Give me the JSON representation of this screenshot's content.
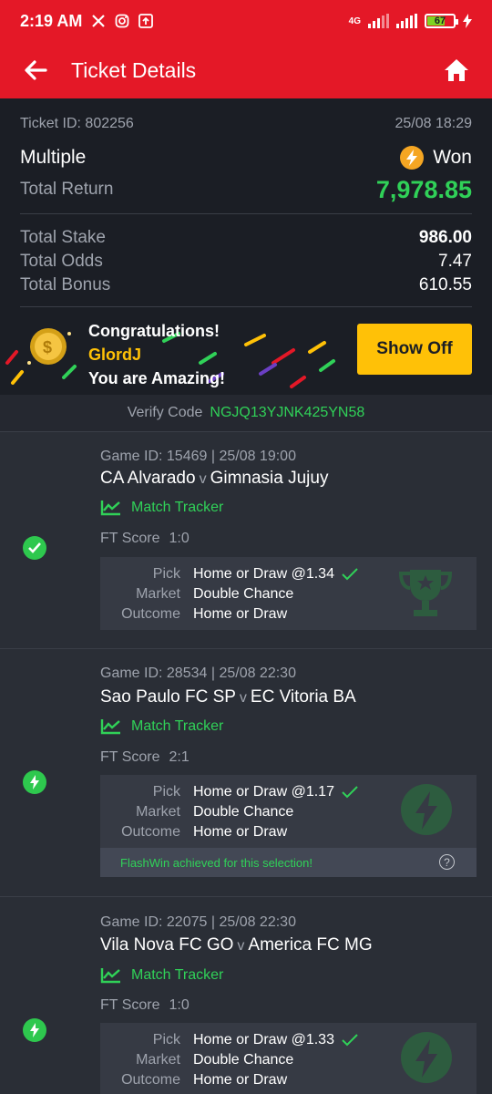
{
  "status_bar": {
    "time": "2:19 AM",
    "network": "4G",
    "battery": "67"
  },
  "header": {
    "title": "Ticket Details"
  },
  "ticket": {
    "id_label": "Ticket ID: 802256",
    "datetime": "25/08 18:29",
    "type": "Multiple",
    "result": "Won",
    "total_return_label": "Total Return",
    "total_return": "7,978.85",
    "stats": [
      {
        "label": "Total Stake",
        "value": "986.00"
      },
      {
        "label": "Total Odds",
        "value": "7.47"
      },
      {
        "label": "Total Bonus",
        "value": "610.55"
      }
    ]
  },
  "congrats": {
    "line1": "Congratulations!",
    "user": "GlordJ",
    "line3": "You are Amazing!",
    "button": "Show Off"
  },
  "verify": {
    "label": "Verify Code",
    "code": "NGJQ13YJNK425YN58"
  },
  "games": [
    {
      "meta": "Game ID: 15469 | 25/08 19:00",
      "home": "CA Alvarado",
      "vs": "v",
      "away": "Gimnasia Jujuy",
      "tracker": "Match Tracker",
      "ft_label": "FT Score",
      "ft_score": "1:0",
      "pick_label": "Pick",
      "pick": "Home or Draw @1.34",
      "market_label": "Market",
      "market": "Double Chance",
      "outcome_label": "Outcome",
      "outcome": "Home or Draw",
      "status_icon": "check-icon"
    },
    {
      "meta": "Game ID: 28534 | 25/08 22:30",
      "home": "Sao Paulo FC SP",
      "vs": "v",
      "away": "EC Vitoria BA",
      "tracker": "Match Tracker",
      "ft_label": "FT Score",
      "ft_score": "2:1",
      "pick_label": "Pick",
      "pick": "Home or Draw @1.17",
      "market_label": "Market",
      "market": "Double Chance",
      "outcome_label": "Outcome",
      "outcome": "Home or Draw",
      "flash": "FlashWin achieved for this selection!",
      "status_icon": "flash-icon"
    },
    {
      "meta": "Game ID: 22075 | 25/08 22:30",
      "home": "Vila Nova FC GO",
      "vs": "v",
      "away": "America FC MG",
      "tracker": "Match Tracker",
      "ft_label": "FT Score",
      "ft_score": "1:0",
      "pick_label": "Pick",
      "pick": "Home or Draw @1.33",
      "market_label": "Market",
      "market": "Double Chance",
      "outcome_label": "Outcome",
      "outcome": "Home or Draw",
      "status_icon": "flash-icon"
    }
  ],
  "colors": {
    "brand_red": "#e41827",
    "win_green": "#30d158",
    "accent_yellow": "#ffc107"
  }
}
